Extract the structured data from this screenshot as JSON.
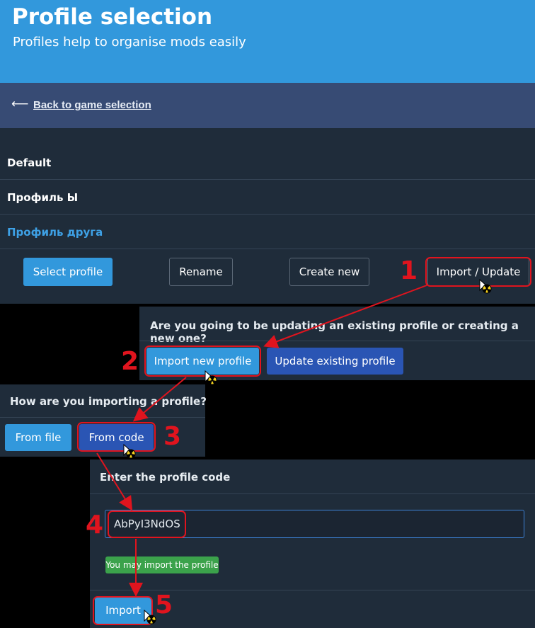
{
  "hero": {
    "title": "Profile selection",
    "subtitle": "Profiles help to organise mods easily"
  },
  "back": {
    "arrow": "⟵",
    "label": "Back to game selection"
  },
  "profiles": [
    {
      "name": "Default",
      "selected": false
    },
    {
      "name": "Профиль Ы",
      "selected": false
    },
    {
      "name": "Профиль друга",
      "selected": true
    }
  ],
  "actions": {
    "select": "Select profile",
    "rename": "Rename",
    "create": "Create new",
    "import": "Import / Update"
  },
  "modal_import_type": {
    "question": "Are you going to be updating an existing profile or creating a new one?",
    "import_new": "Import new profile",
    "update_existing": "Update existing profile"
  },
  "modal_import_source": {
    "question": "How are you importing a profile?",
    "from_file": "From file",
    "from_code": "From code"
  },
  "modal_code": {
    "heading": "Enter the profile code",
    "code_value": "AbPyI3NdOS",
    "status": "You may import the profile",
    "import_button": "Import"
  },
  "steps": [
    "1",
    "2",
    "3",
    "4",
    "5"
  ],
  "colors": {
    "accent_blue": "#3298dc",
    "dark_blue": "#2a55b4",
    "panel": "#1f2c3a",
    "annotation_red": "#e0141e",
    "success_green": "#3ba24b"
  },
  "icons": {
    "cursor": "radioactive-cursor-icon"
  }
}
